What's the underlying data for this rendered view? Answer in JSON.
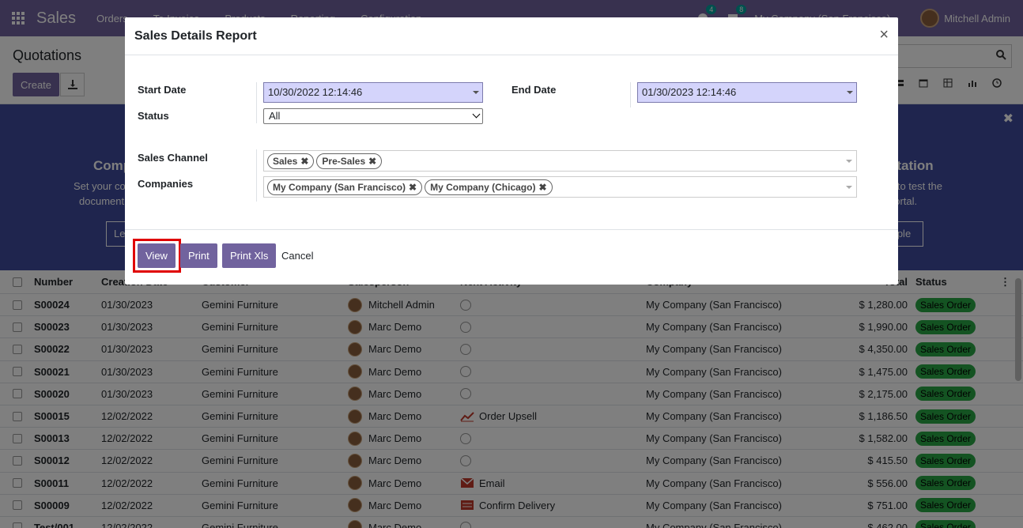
{
  "navbar": {
    "brand": "Sales",
    "menu": [
      "Orders",
      "To Invoice",
      "Products",
      "Reporting",
      "Configuration"
    ],
    "activity_count": "4",
    "message_count": "8",
    "company": "My Company (San Francisco)",
    "user": "Mitchell Admin"
  },
  "control_panel": {
    "breadcrumb": "Quotations",
    "create_label": "Create"
  },
  "banner": {
    "left_title": "Comp",
    "left_text1": "Set your co",
    "left_text2": "document",
    "left_btn": "Le",
    "right_title": "otation",
    "right_text1": "n to test the",
    "right_text2": "portal.",
    "right_btn": "mple"
  },
  "list": {
    "columns": [
      "Number",
      "Creation Date",
      "Customer",
      "Salesperson",
      "Next Activity",
      "Company",
      "Total",
      "Status"
    ],
    "rows": [
      {
        "number": "S00024",
        "date": "01/30/2023",
        "customer": "Gemini Furniture",
        "salesperson": "Mitchell Admin",
        "activity": "",
        "activity_icon": "clock-icon",
        "company": "My Company (San Francisco)",
        "total": "$ 1,280.00",
        "status": "Sales Order"
      },
      {
        "number": "S00023",
        "date": "01/30/2023",
        "customer": "Gemini Furniture",
        "salesperson": "Marc Demo",
        "activity": "",
        "activity_icon": "clock-icon",
        "company": "My Company (San Francisco)",
        "total": "$ 1,990.00",
        "status": "Sales Order"
      },
      {
        "number": "S00022",
        "date": "01/30/2023",
        "customer": "Gemini Furniture",
        "salesperson": "Marc Demo",
        "activity": "",
        "activity_icon": "clock-icon",
        "company": "My Company (San Francisco)",
        "total": "$ 4,350.00",
        "status": "Sales Order"
      },
      {
        "number": "S00021",
        "date": "01/30/2023",
        "customer": "Gemini Furniture",
        "salesperson": "Marc Demo",
        "activity": "",
        "activity_icon": "clock-icon",
        "company": "My Company (San Francisco)",
        "total": "$ 1,475.00",
        "status": "Sales Order"
      },
      {
        "number": "S00020",
        "date": "01/30/2023",
        "customer": "Gemini Furniture",
        "salesperson": "Marc Demo",
        "activity": "",
        "activity_icon": "clock-icon",
        "company": "My Company (San Francisco)",
        "total": "$ 2,175.00",
        "status": "Sales Order"
      },
      {
        "number": "S00015",
        "date": "12/02/2022",
        "customer": "Gemini Furniture",
        "salesperson": "Marc Demo",
        "activity": "Order Upsell",
        "activity_icon": "chart-icon",
        "company": "My Company (San Francisco)",
        "total": "$ 1,186.50",
        "status": "Sales Order"
      },
      {
        "number": "S00013",
        "date": "12/02/2022",
        "customer": "Gemini Furniture",
        "salesperson": "Marc Demo",
        "activity": "",
        "activity_icon": "clock-icon",
        "company": "My Company (San Francisco)",
        "total": "$ 1,582.00",
        "status": "Sales Order"
      },
      {
        "number": "S00012",
        "date": "12/02/2022",
        "customer": "Gemini Furniture",
        "salesperson": "Marc Demo",
        "activity": "",
        "activity_icon": "clock-icon",
        "company": "My Company (San Francisco)",
        "total": "$ 415.50",
        "status": "Sales Order"
      },
      {
        "number": "S00011",
        "date": "12/02/2022",
        "customer": "Gemini Furniture",
        "salesperson": "Marc Demo",
        "activity": "Email",
        "activity_icon": "envelope-icon",
        "company": "My Company (San Francisco)",
        "total": "$ 556.00",
        "status": "Sales Order"
      },
      {
        "number": "S00009",
        "date": "12/02/2022",
        "customer": "Gemini Furniture",
        "salesperson": "Marc Demo",
        "activity": "Confirm Delivery",
        "activity_icon": "list-icon",
        "company": "My Company (San Francisco)",
        "total": "$ 751.00",
        "status": "Sales Order"
      },
      {
        "number": "Test/001",
        "date": "12/02/2022",
        "customer": "Gemini Furniture",
        "salesperson": "Marc Demo",
        "activity": "",
        "activity_icon": "clock-icon",
        "company": "My Company (San Francisco)",
        "total": "$ 462.00",
        "status": "Sales Order"
      }
    ]
  },
  "dialog": {
    "title": "Sales Details Report",
    "start_date_label": "Start Date",
    "start_date_value": "10/30/2022 12:14:46",
    "end_date_label": "End Date",
    "end_date_value": "01/30/2023 12:14:46",
    "status_label": "Status",
    "status_value": "All",
    "sales_channel_label": "Sales Channel",
    "sales_channel_tags": [
      "Sales",
      "Pre-Sales"
    ],
    "companies_label": "Companies",
    "companies_tags": [
      "My Company (San Francisco)",
      "My Company (Chicago)"
    ],
    "buttons": {
      "view": "View",
      "print": "Print",
      "print_xls": "Print Xls",
      "cancel": "Cancel"
    }
  },
  "colors": {
    "brand": "#71639e",
    "status_badge": "#28a745",
    "highlight": "#e00000",
    "date_field": "#d4d4fb"
  }
}
